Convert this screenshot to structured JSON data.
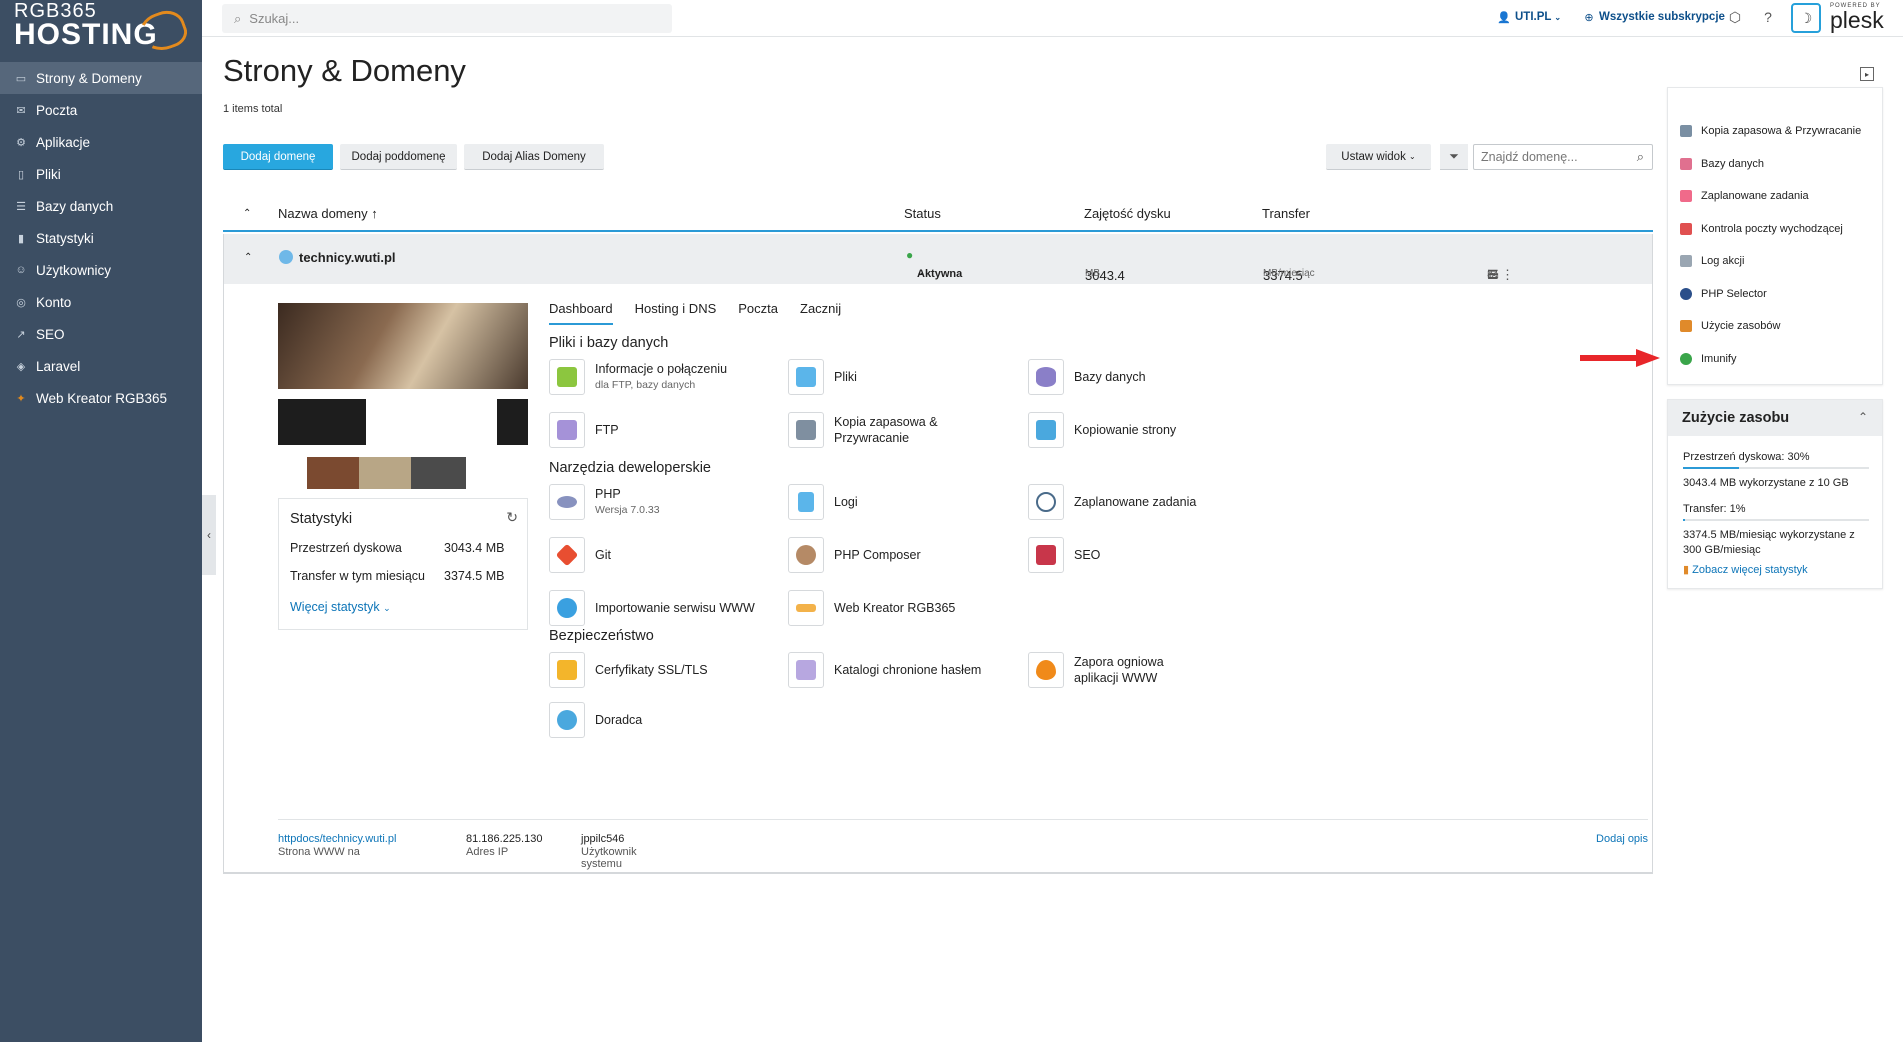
{
  "brand": {
    "line1": "RGB365",
    "line2": "HOSTING"
  },
  "sidebar": {
    "items": [
      {
        "label": "Strony & Domeny",
        "active": true
      },
      {
        "label": "Poczta"
      },
      {
        "label": "Aplikacje"
      },
      {
        "label": "Pliki"
      },
      {
        "label": "Bazy danych"
      },
      {
        "label": "Statystyki"
      },
      {
        "label": "Użytkownicy"
      },
      {
        "label": "Konto"
      },
      {
        "label": "SEO"
      },
      {
        "label": "Laravel"
      },
      {
        "label": "Web Kreator RGB365"
      }
    ]
  },
  "topbar": {
    "search_placeholder": "Szukaj...",
    "account": "UTI.PL",
    "subscriptions": "Wszystkie subskrypcje",
    "plesk_powered": "POWERED BY",
    "plesk": "plesk"
  },
  "page": {
    "title": "Strony & Domeny",
    "items_total": "1 items total",
    "buttons": {
      "add_domain": "Dodaj domenę",
      "add_subdomain": "Dodaj poddomenę",
      "add_alias": "Dodaj Alias Domeny",
      "view": "Ustaw widok",
      "find_placeholder": "Znajdź domenę..."
    },
    "columns": {
      "name": "Nazwa domeny ↑",
      "status": "Status",
      "disk": "Zajętość dysku",
      "transfer": "Transfer"
    }
  },
  "domain": {
    "name": "technicy.wuti.pl",
    "status": "Aktywna",
    "disk_value": "3043.4",
    "disk_unit": "MB",
    "transfer_value": "3374.5",
    "transfer_unit": "MB/miesiąc",
    "tabs": [
      "Dashboard",
      "Hosting i DNS",
      "Poczta",
      "Zacznij"
    ],
    "stats": {
      "title": "Statystyki",
      "disk_label": "Przestrzeń dyskowa",
      "disk_value": "3043.4 MB",
      "transfer_label": "Transfer w tym miesiącu",
      "transfer_value": "3374.5 MB",
      "more": "Więcej statystyk"
    },
    "sections": {
      "files": "Pliki i bazy danych",
      "dev": "Narzędzia deweloperskie",
      "security": "Bezpieczeństwo"
    },
    "tools": {
      "conn": "Informacje o połączeniu",
      "conn_sub": "dla FTP, bazy danych",
      "files": "Pliki",
      "db": "Bazy danych",
      "ftp": "FTP",
      "backup": "Kopia zapasowa & Przywracanie",
      "copy": "Kopiowanie strony",
      "php": "PHP",
      "php_sub": "Wersja 7.0.33",
      "logs": "Logi",
      "sched": "Zaplanowane zadania",
      "git": "Git",
      "composer": "PHP Composer",
      "seo": "SEO",
      "import": "Importowanie serwisu WWW",
      "webkreator": "Web Kreator RGB365",
      "ssl": "Cerfyfikaty SSL/TLS",
      "protected": "Katalogi chronione hasłem",
      "waf": "Zapora ogniowa aplikacji WWW",
      "advisor": "Doradca"
    },
    "footer": {
      "site_prefix": "Strona WWW na",
      "site_link": "httpdocs/technicy.wuti.pl",
      "ip_label": "Adres IP",
      "ip": "81.186.225.130",
      "user_label": "Użytkownik systemu",
      "user": "jppilc546",
      "add_desc": "Dodaj opis"
    }
  },
  "right_panel": {
    "items": [
      {
        "label": "Kopia zapasowa & Przywracanie",
        "color": "#7a8fa3"
      },
      {
        "label": "Bazy danych",
        "color": "#e0708f"
      },
      {
        "label": "Zaplanowane zadania",
        "color": "#f06a8a"
      },
      {
        "label": "Kontrola poczty wychodzącej",
        "color": "#e05050"
      },
      {
        "label": "Log akcji",
        "color": "#9aa6b2"
      },
      {
        "label": "PHP Selector",
        "color": "#2b4f8a"
      },
      {
        "label": "Użycie zasobów",
        "color": "#e08a2a"
      },
      {
        "label": "Imunify",
        "color": "#3aa54a"
      }
    ]
  },
  "usage": {
    "title": "Zużycie zasobu",
    "disk_label": "Przestrzeń dyskowa: 30%",
    "disk_percent": 30,
    "disk_detail": "3043.4 MB wykorzystane z 10 GB",
    "transfer_label": "Transfer: 1%",
    "transfer_percent": 1,
    "transfer_detail": "3374.5 MB/miesiąc wykorzystane z 300 GB/miesiąc",
    "more": "Zobacz więcej statystyk"
  },
  "colors": {
    "accent": "#28a7df",
    "sidebar": "#3c4e63",
    "arrow": "#e8262a",
    "status_active": "#3aa54a"
  }
}
